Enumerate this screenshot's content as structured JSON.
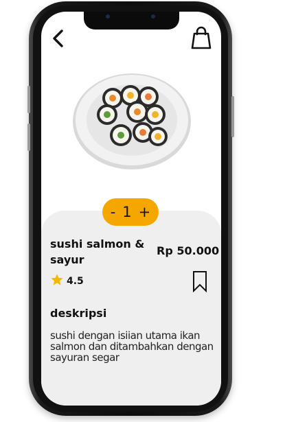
{
  "product": {
    "name": "sushi salmon & sayur",
    "price": "Rp 50.000",
    "rating": "4.5",
    "description_heading": "deskripsi",
    "description": "sushi dengan isiian utama ikan salmon dan ditambahkan dengan sayuran segar"
  },
  "quantity": {
    "decrement_label": "-",
    "value": "1",
    "increment_label": "+"
  },
  "icons": {
    "back": "chevron-left-icon",
    "cart": "shopping-bag-icon",
    "rating": "star-icon",
    "save": "bookmark-icon"
  },
  "colors": {
    "accent": "#f5a700",
    "panel": "#efefef",
    "star": "#f5b800"
  }
}
